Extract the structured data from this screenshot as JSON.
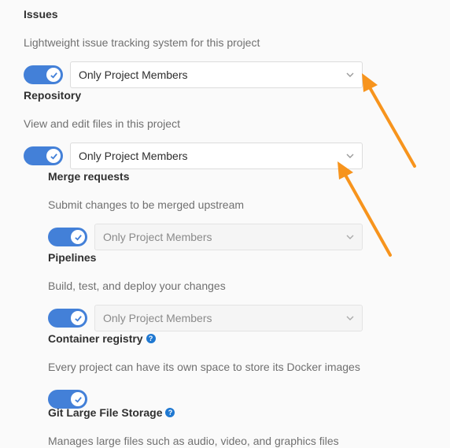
{
  "sections": [
    {
      "id": "issues",
      "title": "Issues",
      "description": "Lightweight issue tracking system for this project",
      "enabled": true,
      "access": "Only Project Members"
    },
    {
      "id": "repository",
      "title": "Repository",
      "description": "View and edit files in this project",
      "enabled": true,
      "access": "Only Project Members"
    },
    {
      "id": "merge_requests",
      "title": "Merge requests",
      "description": "Submit changes to be merged upstream",
      "enabled": true,
      "access": "Only Project Members"
    },
    {
      "id": "pipelines",
      "title": "Pipelines",
      "description": "Build, test, and deploy your changes",
      "enabled": true,
      "access": "Only Project Members"
    },
    {
      "id": "container_registry",
      "title": "Container registry",
      "description": "Every project can have its own space to store its Docker images",
      "enabled": true,
      "help": "?"
    },
    {
      "id": "git_lfs",
      "title": "Git Large File Storage",
      "description": "Manages large files such as audio, video, and graphics files",
      "help": "?"
    }
  ],
  "colors": {
    "toggle_on": "#4380d8",
    "annotation_arrow": "#f7941d",
    "help_icon": "#1f78d1"
  }
}
